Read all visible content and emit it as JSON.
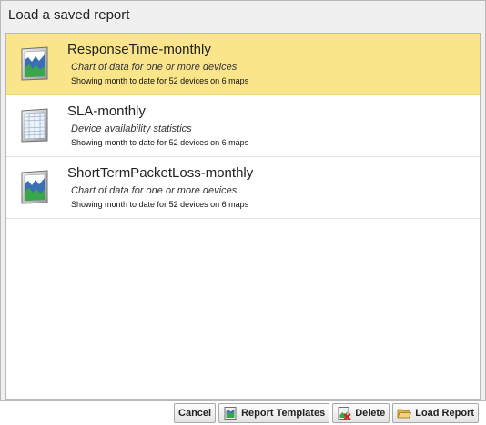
{
  "dialog": {
    "title": "Load a saved report"
  },
  "reports": [
    {
      "name": "ResponseTime-monthly",
      "description": "Chart of data for one or more devices",
      "detail": "Showing month to date for 52 devices on 6 maps",
      "icon": "chart-icon",
      "selected": true
    },
    {
      "name": "SLA-monthly",
      "description": "Device availability statistics",
      "detail": "Showing month to date for 52 devices on 6 maps",
      "icon": "table-icon",
      "selected": false
    },
    {
      "name": "ShortTermPacketLoss-monthly",
      "description": "Chart of data for one or more devices",
      "detail": "Showing month to date for 52 devices on 6 maps",
      "icon": "chart-icon",
      "selected": false
    }
  ],
  "buttons": {
    "cancel": "Cancel",
    "templates": "Report Templates",
    "delete": "Delete",
    "load": "Load Report"
  },
  "colors": {
    "selected_background": "#fbe58a",
    "chart_blue": "#3a6fb5",
    "chart_green": "#3aa64a"
  }
}
